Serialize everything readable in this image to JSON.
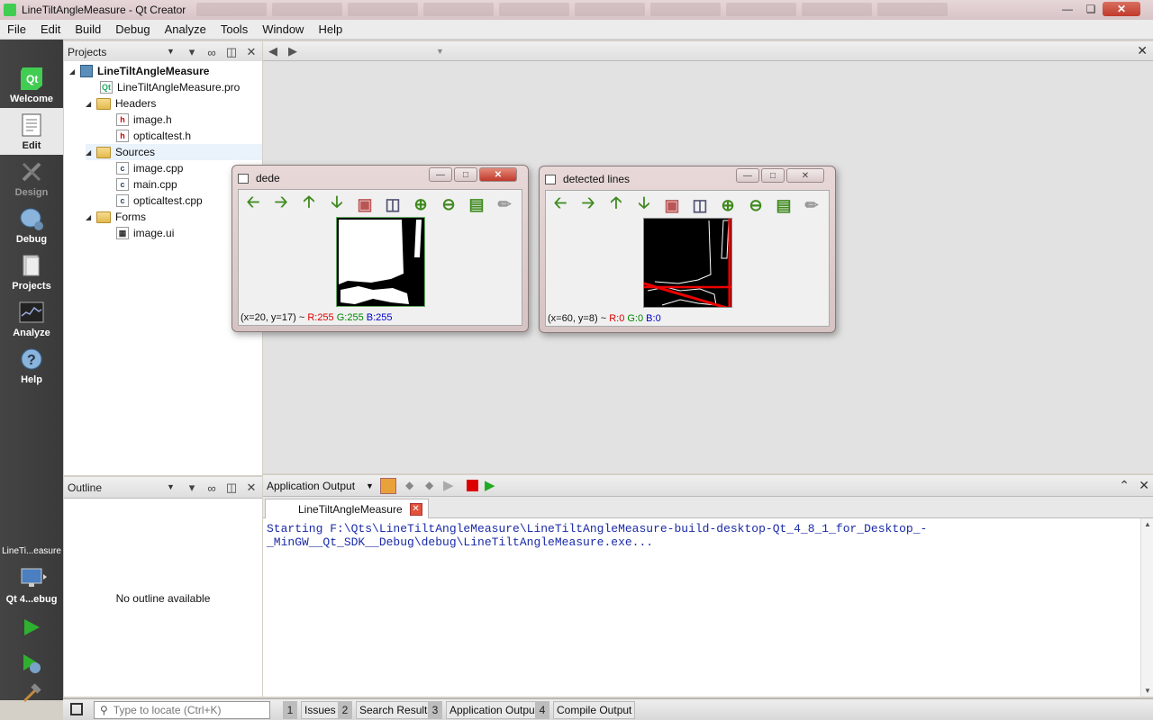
{
  "window": {
    "title": "LineTiltAngleMeasure - Qt Creator"
  },
  "menu": [
    "File",
    "Edit",
    "Build",
    "Debug",
    "Analyze",
    "Tools",
    "Window",
    "Help"
  ],
  "modes": [
    {
      "label": "Welcome",
      "icon": "qt-logo-icon"
    },
    {
      "label": "Edit",
      "icon": "document-icon"
    },
    {
      "label": "Design",
      "icon": "design-pencil-icon"
    },
    {
      "label": "Debug",
      "icon": "bug-icon"
    },
    {
      "label": "Projects",
      "icon": "folder-projects-icon"
    },
    {
      "label": "Analyze",
      "icon": "oscilloscope-icon"
    },
    {
      "label": "Help",
      "icon": "question-icon"
    }
  ],
  "kit": {
    "project": "LineTi...easure",
    "config": "Qt 4...ebug"
  },
  "projects_panel": {
    "title": "Projects",
    "tree": [
      {
        "label": "LineTiltAngleMeasure",
        "type": "project"
      },
      {
        "label": "LineTiltAngleMeasure.pro",
        "type": "pro-file"
      },
      {
        "label": "Headers",
        "type": "folder"
      },
      {
        "label": "image.h",
        "type": "header"
      },
      {
        "label": "opticaltest.h",
        "type": "header"
      },
      {
        "label": "Sources",
        "type": "folder"
      },
      {
        "label": "image.cpp",
        "type": "source"
      },
      {
        "label": "main.cpp",
        "type": "source"
      },
      {
        "label": "opticaltest.cpp",
        "type": "source"
      },
      {
        "label": "Forms",
        "type": "folder"
      },
      {
        "label": "image.ui",
        "type": "form"
      }
    ]
  },
  "outline_panel": {
    "title": "Outline",
    "empty_text": "No outline available"
  },
  "image_windows": [
    {
      "title": "dede",
      "status": {
        "coords": "(x=20, y=17) ~",
        "r": "R:255",
        "g": "G:255",
        "b": "B:255"
      }
    },
    {
      "title": "detected lines",
      "status": {
        "coords": "(x=60, y=8) ~",
        "r": "R:0",
        "g": "G:0",
        "b": "B:0"
      }
    }
  ],
  "output": {
    "pane_title": "Application Output",
    "tab_label": "LineTiltAngleMeasure",
    "line1": "Starting F:\\Qts\\LineTiltAngleMeasure\\LineTiltAngleMeasure-build-desktop-Qt_4_8_1_for_Desktop_-",
    "line2": "_MinGW__Qt_SDK__Debug\\debug\\LineTiltAngleMeasure.exe..."
  },
  "bottom": {
    "locator_placeholder": "Type to locate (Ctrl+K)",
    "tabs": [
      {
        "num": "1",
        "label": "Issues"
      },
      {
        "num": "2",
        "label": "Search Results"
      },
      {
        "num": "3",
        "label": "Application Output"
      },
      {
        "num": "4",
        "label": "Compile Output"
      }
    ]
  },
  "colors": {
    "accent_green": "#41cd52",
    "stop_red": "#d00000",
    "output_text": "#1a2aa8"
  }
}
